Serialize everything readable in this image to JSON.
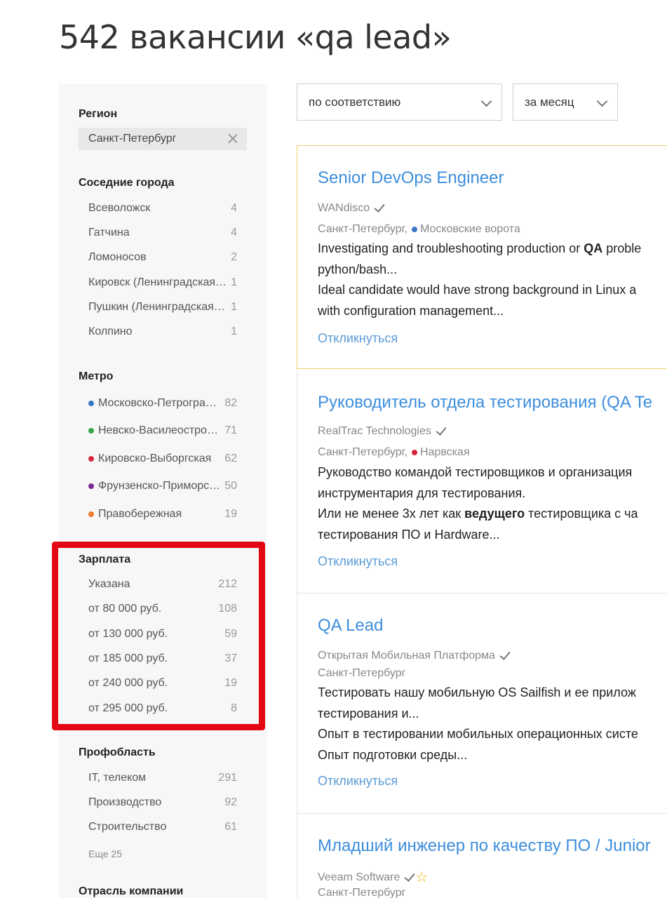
{
  "page": {
    "title": "542 вакансии «qa lead»"
  },
  "sidebar": {
    "region": {
      "title": "Регион",
      "chip": "Санкт-Петербург"
    },
    "nearby": {
      "title": "Соседние города",
      "items": [
        {
          "label": "Всеволожск",
          "count": "4"
        },
        {
          "label": "Гатчина",
          "count": "4"
        },
        {
          "label": "Ломоносов",
          "count": "2"
        },
        {
          "label": "Кировск (Ленинградская область)",
          "count": "1"
        },
        {
          "label": "Пушкин (Ленинградская область)",
          "count": "1"
        },
        {
          "label": "Колпино",
          "count": "1"
        }
      ]
    },
    "metro": {
      "title": "Метро",
      "items": [
        {
          "label": "Московско-Петроградская",
          "count": "82",
          "color": "#3c78c8"
        },
        {
          "label": "Невско-Василеостровская",
          "count": "71",
          "color": "#3aa64a"
        },
        {
          "label": "Кировско-Выборгская",
          "count": "62",
          "color": "#d6283c"
        },
        {
          "label": "Фрунзенско-Приморская",
          "count": "50",
          "color": "#7b2a96"
        },
        {
          "label": "Правобережная",
          "count": "19",
          "color": "#ee7b30"
        }
      ]
    },
    "salary": {
      "title": "Зарплата",
      "items": [
        {
          "label": "Указана",
          "count": "212"
        },
        {
          "label": "от 80 000 руб.",
          "count": "108"
        },
        {
          "label": "от 130 000 руб.",
          "count": "59"
        },
        {
          "label": "от 185 000 руб.",
          "count": "37"
        },
        {
          "label": "от 240 000 руб.",
          "count": "19"
        },
        {
          "label": "от 295 000 руб.",
          "count": "8"
        }
      ]
    },
    "profarea": {
      "title": "Профобласть",
      "items": [
        {
          "label": "IT, телеком",
          "count": "291"
        },
        {
          "label": "Производство",
          "count": "92"
        },
        {
          "label": "Строительство",
          "count": "61"
        }
      ],
      "more": "Еще 25"
    },
    "industry": {
      "title": "Отрасль компании"
    }
  },
  "toolbar": {
    "sort": "по соответствию",
    "period": "за месяц"
  },
  "vacancies": [
    {
      "title": "Senior DevOps Engineer",
      "company": "WANdisco",
      "city": "Санкт-Петербург,",
      "metro": "Московские ворота",
      "metro_color": "#3c78c8",
      "line1_a": "Investigating and troubleshooting production or ",
      "line1_b": "QA",
      "line1_c": " proble",
      "line2": "python/bash...",
      "line3": "Ideal candidate would have strong background in Linux a",
      "line4": "with configuration management...",
      "apply": "Откликнуться"
    },
    {
      "title": "Руководитель отдела тестирования (QA Te",
      "company": "RealTrac Technologies",
      "city": "Санкт-Петербург,",
      "metro": "Нарвская",
      "metro_color": "#d6283c",
      "line1": "Руководство командой тестировщиков и организация",
      "line2": "инструментария для тестирования.",
      "line3_a": "Или не менее 3х лет как ",
      "line3_b": "ведущего",
      "line3_c": " тестировщика с ча",
      "line4": "тестирования ПО и Hardware...",
      "apply": "Откликнуться"
    },
    {
      "title": "QA Lead",
      "company": "Открытая Мобильная Платформа",
      "city": "Санкт-Петербург",
      "line1": "Тестировать нашу мобильную OS Sailfish и ее прилож",
      "line2": "тестирования и...",
      "line3": "Опыт в тестировании мобильных операционных систе",
      "line4": "Опыт подготовки среды...",
      "apply": "Откликнуться"
    },
    {
      "title": "Младший инженер по качеству ПО / Junior",
      "company": "Veeam Software",
      "city": "Санкт-Петербург"
    }
  ]
}
